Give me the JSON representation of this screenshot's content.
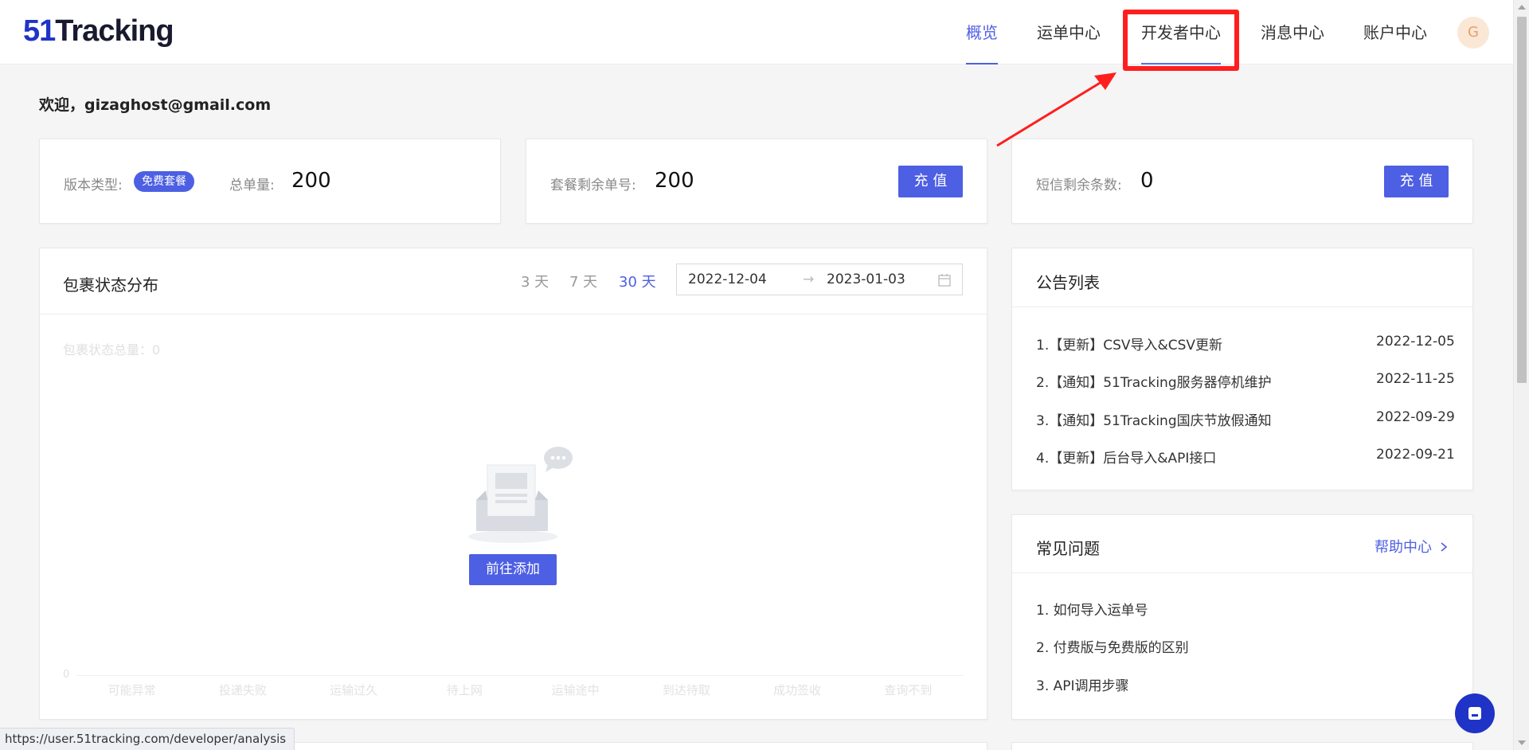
{
  "app": {
    "logo_num": "51",
    "logo_text": "Tracking"
  },
  "nav": {
    "items": [
      {
        "label": "概览",
        "active": true
      },
      {
        "label": "运单中心",
        "active": false
      },
      {
        "label": "开发者中心",
        "active": false
      },
      {
        "label": "消息中心",
        "active": false
      },
      {
        "label": "账户中心",
        "active": false
      }
    ],
    "avatar_initial": "G"
  },
  "welcome": "欢迎，gizaghost@gmail.com",
  "stats": {
    "version_label": "版本类型:",
    "version_badge": "免费套餐",
    "total_label": "总单量:",
    "total_value": "200",
    "remaining_label": "套餐剩余单号:",
    "remaining_value": "200",
    "recharge_label": "充 值",
    "sms_label": "短信剩余条数:",
    "sms_value": "0",
    "sms_recharge_label": "充 值"
  },
  "package_status": {
    "title": "包裹状态分布",
    "ranges": [
      "3 天",
      "7 天",
      "30 天"
    ],
    "active_range": "30 天",
    "start_date": "2022-12-04",
    "end_date": "2023-01-03",
    "date_separator": "→",
    "total_label": "包裹状态总量：0",
    "axis_zero": "0",
    "add_button": "前往添加",
    "chart_data": {
      "type": "bar",
      "categories": [
        "可能异常",
        "投递失败",
        "运输过久",
        "待上网",
        "运输途中",
        "到达待取",
        "成功签收",
        "查询不到"
      ],
      "values": [
        0,
        0,
        0,
        0,
        0,
        0,
        0,
        0
      ]
    }
  },
  "announcements": {
    "title": "公告列表",
    "items": [
      {
        "text": "1.【更新】CSV导入&CSV更新",
        "date": "2022-12-05"
      },
      {
        "text": "2.【通知】51Tracking服务器停机维护",
        "date": "2022-11-25"
      },
      {
        "text": "3.【通知】51Tracking国庆节放假通知",
        "date": "2022-09-29"
      },
      {
        "text": "4.【更新】后台导入&API接口",
        "date": "2022-09-21"
      }
    ]
  },
  "faq": {
    "title": "常见问题",
    "help_link": "帮助中心",
    "items": [
      "1. 如何导入运单号",
      "2. 付费版与免费版的区别",
      "3. API调用步骤"
    ]
  },
  "status_bar_url": "https://user.51tracking.com/developer/analysis",
  "colors": {
    "accent": "#4d5fe3",
    "brand": "#1f33c7",
    "highlight": "#ff1e1e"
  }
}
